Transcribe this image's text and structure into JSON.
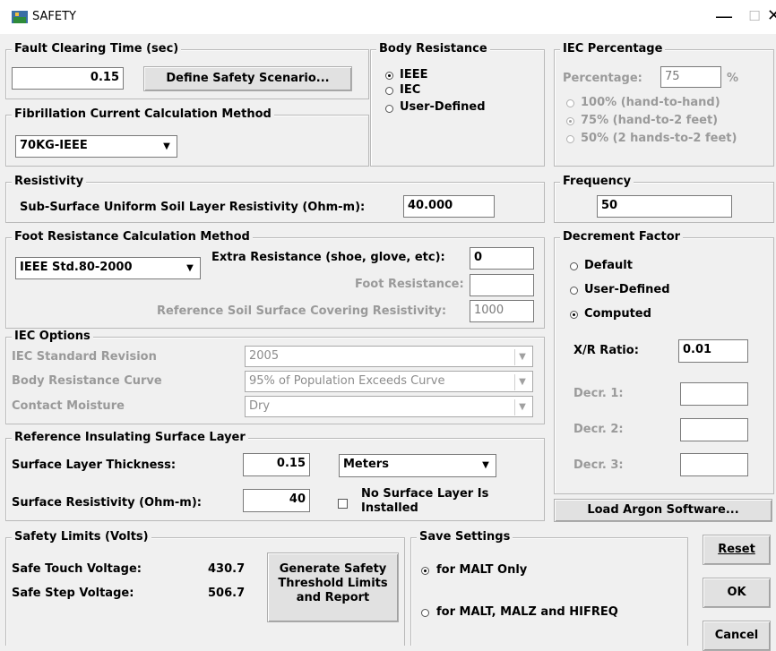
{
  "window": {
    "title": "SAFETY",
    "minimize": "—",
    "maximize": "☐",
    "close": "✕"
  },
  "fault_clearing": {
    "title": "Fault Clearing Time (sec)",
    "value": "0.15",
    "define_button": "Define Safety Scenario..."
  },
  "fibrillation": {
    "title": "Fibrillation Current Calculation Method",
    "value": "70KG-IEEE"
  },
  "body_resistance": {
    "title": "Body Resistance",
    "options": [
      "IEEE",
      "IEC",
      "User-Defined"
    ],
    "selected": "IEEE"
  },
  "iec_percentage": {
    "title": "IEC Percentage",
    "percentage_label": "Percentage:",
    "percentage_value": "75",
    "unit": "%",
    "options": [
      "100% (hand-to-hand)",
      "75% (hand-to-2 feet)",
      "50% (2 hands-to-2 feet)"
    ],
    "selected": "75% (hand-to-2 feet)"
  },
  "resistivity": {
    "title": "Resistivity",
    "label": "Sub-Surface Uniform Soil Layer Resistivity (Ohm-m):",
    "value": "40.000"
  },
  "frequency": {
    "title": "Frequency",
    "value": "50"
  },
  "foot_resistance": {
    "title": "Foot Resistance Calculation Method",
    "method": "IEEE Std.80-2000",
    "extra_label": "Extra Resistance (shoe, glove, etc):",
    "extra_value": "0",
    "foot_label": "Foot Resistance:",
    "foot_value": "",
    "ref_label": "Reference Soil Surface Covering Resistivity:",
    "ref_value": "1000"
  },
  "decrement": {
    "title": "Decrement Factor",
    "options": [
      "Default",
      "User-Defined",
      "Computed"
    ],
    "selected": "Computed",
    "xr_label": "X/R Ratio:",
    "xr_value": "0.01",
    "decr1_label": "Decr. 1:",
    "decr2_label": "Decr. 2:",
    "decr3_label": "Decr. 3:",
    "decr1": "",
    "decr2": "",
    "decr3": ""
  },
  "iec_options": {
    "title": "IEC Options",
    "std_label": "IEC Standard Revision",
    "std_value": "2005",
    "curve_label": "Body Resistance Curve",
    "curve_value": "95% of Population Exceeds Curve",
    "moisture_label": "Contact Moisture",
    "moisture_value": "Dry"
  },
  "surface_layer": {
    "title": "Reference Insulating Surface Layer",
    "thickness_label": "Surface Layer Thickness:",
    "thickness_value": "0.15",
    "unit": "Meters",
    "resistivity_label": "Surface Resistivity (Ohm-m):",
    "resistivity_value": "40",
    "no_layer_label_1": "No Surface Layer Is",
    "no_layer_label_2": "Installed"
  },
  "load_argon": "Load Argon Software...",
  "safety_limits": {
    "title": "Safety Limits (Volts)",
    "touch_label": "Safe Touch Voltage:",
    "touch_value": "430.7",
    "step_label": "Safe Step Voltage:",
    "step_value": "506.7",
    "generate_1": "Generate Safety",
    "generate_2": "Threshold Limits",
    "generate_3": "and Report"
  },
  "save_settings": {
    "title": "Save Settings",
    "options": [
      "for MALT Only",
      "for MALT,  MALZ and HIFREQ"
    ],
    "selected": "for MALT Only"
  },
  "buttons": {
    "reset": "Reset",
    "ok": "OK",
    "cancel": "Cancel"
  }
}
